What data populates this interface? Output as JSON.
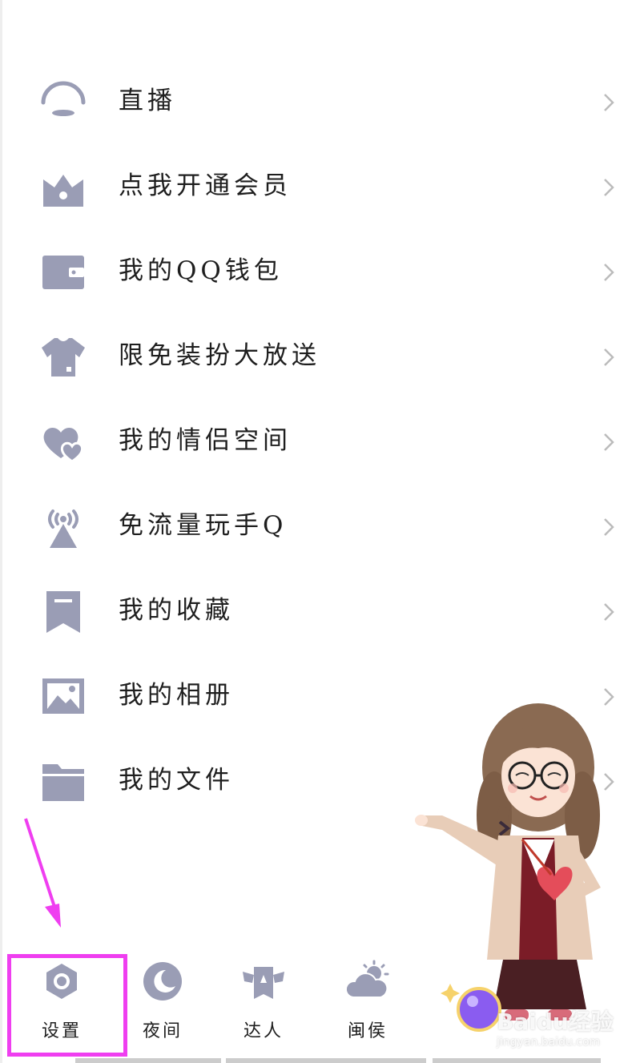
{
  "colors": {
    "icon": "#9a9db5",
    "text": "#1e1e1e",
    "chevron": "#bbbbbb",
    "highlight": "#ef3ef0"
  },
  "menu": {
    "items": [
      {
        "label": "直播",
        "icon": "live-icon"
      },
      {
        "label": "点我开通会员",
        "icon": "crown-icon"
      },
      {
        "label": "我的QQ钱包",
        "icon": "wallet-icon"
      },
      {
        "label": "限免装扮大放送",
        "icon": "tshirt-icon"
      },
      {
        "label": "我的情侣空间",
        "icon": "couple-hearts-icon"
      },
      {
        "label": "免流量玩手Q",
        "icon": "signal-tower-icon"
      },
      {
        "label": "我的收藏",
        "icon": "bookmark-icon"
      },
      {
        "label": "我的相册",
        "icon": "photo-icon"
      },
      {
        "label": "我的文件",
        "icon": "folder-icon"
      }
    ]
  },
  "bottom_bar": {
    "settings": {
      "label": "设置",
      "icon": "settings-icon"
    },
    "night": {
      "label": "夜间",
      "icon": "moon-icon"
    },
    "expert": {
      "label": "达人",
      "icon": "winged-badge-icon"
    },
    "weather": {
      "label": "闽侯",
      "icon": "weather-icon"
    }
  },
  "watermark": {
    "text": "Baidu经验",
    "url_text": "jingyan.baidu.com"
  }
}
